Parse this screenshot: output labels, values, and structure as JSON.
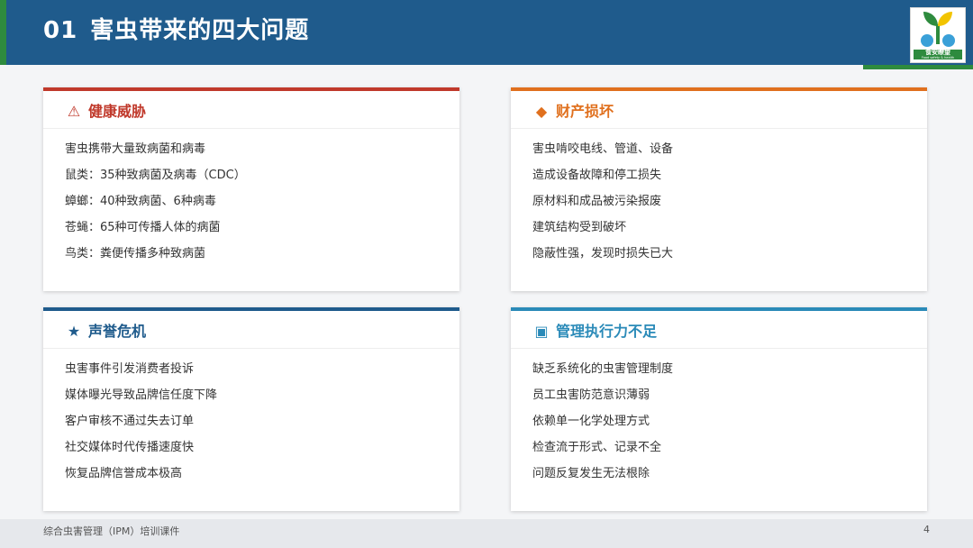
{
  "header": {
    "number": "01",
    "title": "害虫带来的四大问题",
    "colors": {
      "band": "#1f5b8c",
      "accent": "#2e8b3e"
    }
  },
  "logo": {
    "text": "食安瞭望",
    "subtitle": "Food safety & health"
  },
  "cards": [
    {
      "icon": "warning-icon",
      "icon_glyph": "⚠",
      "title": "健康威胁",
      "color": "#c0392b",
      "items": [
        "害虫携带大量致病菌和病毒",
        "鼠类：35种致病菌及病毒（CDC）",
        "蟑螂：40种致病菌、6种病毒",
        "苍蝇：65种可传播人体的病菌",
        "鸟类：粪便传播多种致病菌"
      ]
    },
    {
      "icon": "diamond-icon",
      "icon_glyph": "◆",
      "title": "财产损坏",
      "color": "#e0701e",
      "items": [
        "害虫啃咬电线、管道、设备",
        "造成设备故障和停工损失",
        "原材料和成品被污染报废",
        "建筑结构受到破坏",
        "隐蔽性强，发现时损失已大"
      ]
    },
    {
      "icon": "star-icon",
      "icon_glyph": "★",
      "title": "声誉危机",
      "color": "#1f5b8c",
      "items": [
        "虫害事件引发消费者投诉",
        "媒体曝光导致品牌信任度下降",
        "客户审核不通过失去订单",
        "社交媒体时代传播速度快",
        "恢复品牌信誉成本极高"
      ]
    },
    {
      "icon": "square-icon",
      "icon_glyph": "▣",
      "title": "管理执行力不足",
      "color": "#2a8ab8",
      "items": [
        "缺乏系统化的虫害管理制度",
        "员工虫害防范意识薄弱",
        "依赖单一化学处理方式",
        "检查流于形式、记录不全",
        "问题反复发生无法根除"
      ]
    }
  ],
  "footer": {
    "text": "综合虫害管理（IPM）培训课件",
    "page": "4"
  }
}
